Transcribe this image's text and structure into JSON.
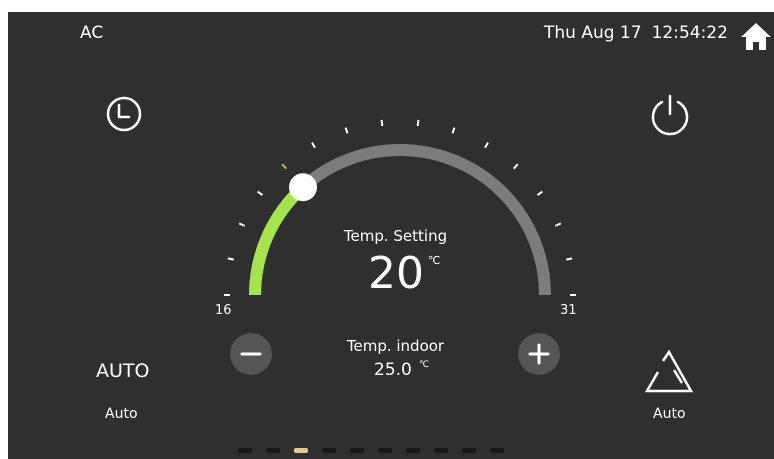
{
  "header": {
    "title": "AC",
    "date": "Thu Aug 17",
    "time": "12:54:22"
  },
  "icons": {
    "home": "home-icon",
    "timer": "clock-icon",
    "power": "power-icon",
    "minus": "minus-icon",
    "plus": "plus-icon",
    "fan": "triangle-icon"
  },
  "setpoint": {
    "label": "Temp. Setting",
    "value": "20",
    "unit": "℃",
    "min": 16,
    "max": 31,
    "min_label": "16",
    "max_label": "31"
  },
  "indoor": {
    "label": "Temp. indoor",
    "value": "25.0",
    "unit": "℃"
  },
  "mode": {
    "value": "AUTO",
    "label": "Auto"
  },
  "fan": {
    "label": "Auto"
  },
  "pager": {
    "count": 10,
    "active": 2
  },
  "colors": {
    "background": "#2f2f2f",
    "track": "#7c7c7c",
    "active_arc": "#a6e44b",
    "active_tick": "#e7a84f",
    "text": "#ffffff",
    "button_fill": "#555555",
    "pager_active": "#e7c88f"
  }
}
